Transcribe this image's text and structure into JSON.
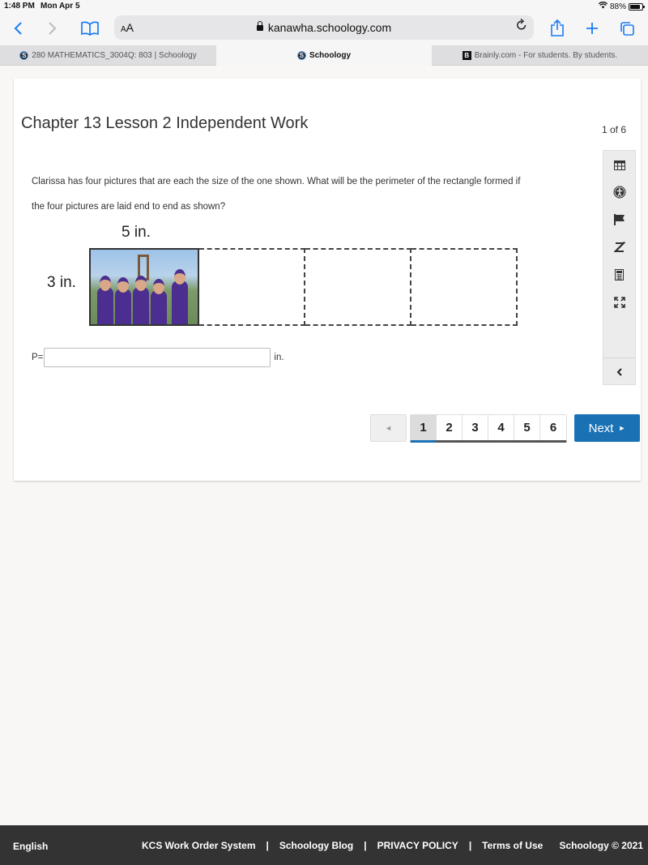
{
  "status_bar": {
    "time": "1:48 PM",
    "date": "Mon Apr 5",
    "battery_text": "88%",
    "battery_level": 0.88
  },
  "browser": {
    "reader_label": "AA",
    "url": "kanawha.schoology.com",
    "icons": [
      "back-icon",
      "forward-icon",
      "bookmarks-icon",
      "lock-icon",
      "reload-icon",
      "share-icon",
      "new-tab-icon",
      "tabs-icon"
    ],
    "tabs": [
      {
        "label": "280 MATHEMATICS_3004Q: 803 | Schoology",
        "icon": "S",
        "active": false
      },
      {
        "label": "Schoology",
        "icon": "S",
        "active": true
      },
      {
        "label": "Brainly.com - For students. By students.",
        "icon": "B",
        "active": false
      }
    ],
    "tab_close_glyph": "✕"
  },
  "assessment": {
    "title": "Chapter 13 Lesson 2 Independent Work",
    "counter": "1 of 6",
    "question_line1": "Clarissa has four pictures that are each the size of the one shown. What will be the perimeter of the rectangle formed if",
    "question_line2": "the four pictures are laid end to end as shown?",
    "figure": {
      "width_label": "5 in.",
      "height_label": "3 in.",
      "picture_count": 4
    },
    "answer": {
      "prefix": "P=",
      "value": "",
      "suffix": "in."
    }
  },
  "side_tools": [
    {
      "name": "calendar-icon",
      "glyph": "▦"
    },
    {
      "name": "accessibility-icon",
      "glyph": "✪"
    },
    {
      "name": "flag-icon",
      "glyph": "⚑"
    },
    {
      "name": "eliminate-icon",
      "glyph": "Z̸"
    },
    {
      "name": "calculator-icon",
      "glyph": "▤"
    },
    {
      "name": "expand-icon",
      "glyph": "⤡"
    },
    {
      "name": "collapse-icon",
      "glyph": "‹"
    }
  ],
  "pagination": {
    "prev_glyph": "◄",
    "pages": [
      "1",
      "2",
      "3",
      "4",
      "5",
      "6"
    ],
    "current": "1",
    "next_label": "Next",
    "next_glyph": "►"
  },
  "footer": {
    "language": "English",
    "links": [
      "KCS Work Order System",
      "Schoology Blog",
      "PRIVACY POLICY",
      "Terms of Use"
    ],
    "separator": "|",
    "copyright": "Schoology © 2021"
  },
  "colors": {
    "primary": "#1a72b5",
    "footer_bg": "#333333",
    "browser_blue": "#1a7cf3"
  }
}
